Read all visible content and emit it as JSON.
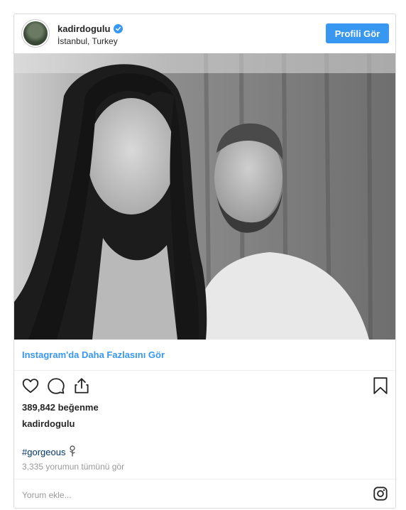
{
  "header": {
    "username": "kadirdogulu",
    "location": "İstanbul, Turkey",
    "profile_button": "Profili Gör"
  },
  "post": {
    "more_link": "Instagram'da Daha Fazlasını Gör",
    "likes": "389,842 beğenme",
    "caption_username": "kadirdogulu",
    "hashtag": "#gorgeous",
    "view_comments": "3,335 yorumun tümünü gör",
    "comment_placeholder": "Yorum ekle..."
  },
  "colors": {
    "accent": "#3897f0",
    "hashtag": "#003569",
    "muted": "#999999",
    "border": "#dbdbdb"
  },
  "icons": [
    "heart-icon",
    "comment-icon",
    "share-icon",
    "bookmark-icon",
    "rose-icon",
    "instagram-logo-icon",
    "verified-badge-icon"
  ]
}
